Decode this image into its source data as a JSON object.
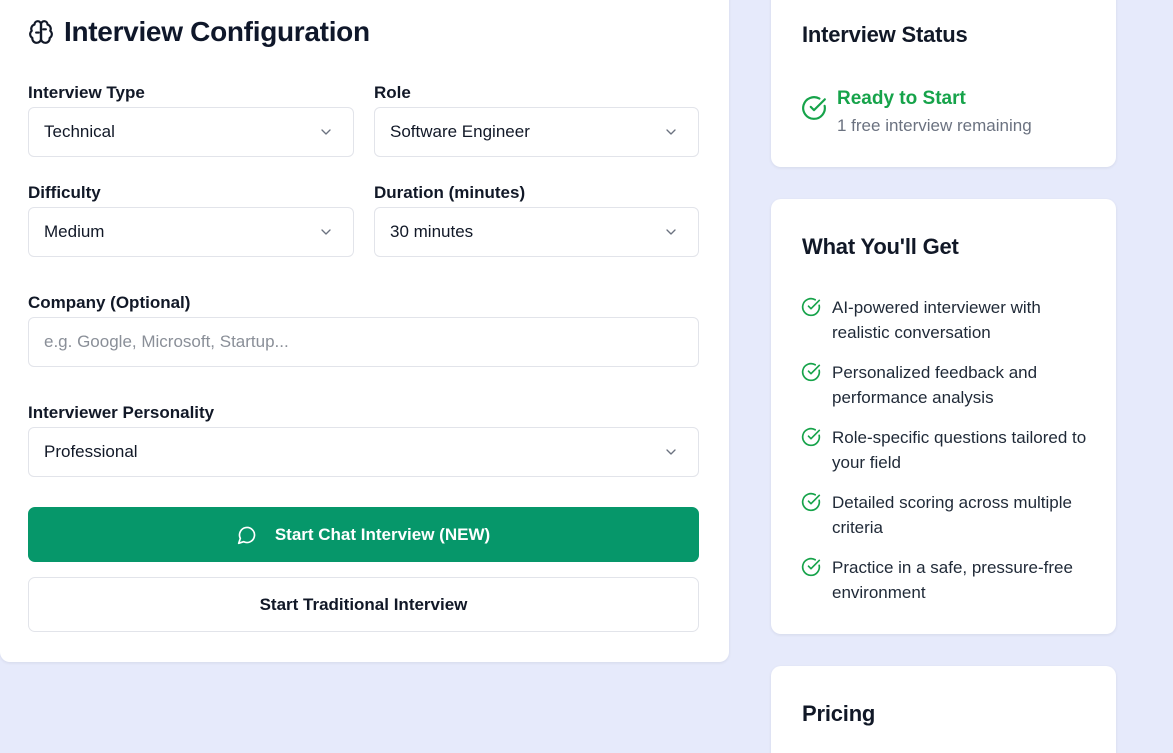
{
  "config": {
    "title": "Interview Configuration",
    "fields": {
      "interview_type": {
        "label": "Interview Type",
        "value": "Technical"
      },
      "role": {
        "label": "Role",
        "value": "Software Engineer"
      },
      "difficulty": {
        "label": "Difficulty",
        "value": "Medium"
      },
      "duration": {
        "label": "Duration (minutes)",
        "value": "30 minutes"
      },
      "company": {
        "label": "Company (Optional)",
        "placeholder": "e.g. Google, Microsoft, Startup...",
        "value": ""
      },
      "personality": {
        "label": "Interviewer Personality",
        "value": "Professional"
      }
    },
    "primary_button": "Start Chat Interview (NEW)",
    "secondary_button": "Start Traditional Interview"
  },
  "status": {
    "title": "Interview Status",
    "state": "Ready to Start",
    "detail": "1 free interview remaining"
  },
  "benefits": {
    "title": "What You'll Get",
    "items": [
      "AI-powered interviewer with realistic conversation",
      "Personalized feedback and performance analysis",
      "Role-specific questions tailored to your field",
      "Detailed scoring across multiple criteria",
      "Practice in a safe, pressure-free environment"
    ]
  },
  "pricing": {
    "title": "Pricing"
  },
  "colors": {
    "accent": "#06976a",
    "success": "#16a34a",
    "background": "#e6eafb"
  },
  "icons": [
    "brain-icon",
    "chevron-down-icon",
    "chat-bubble-icon",
    "check-circle-icon"
  ]
}
